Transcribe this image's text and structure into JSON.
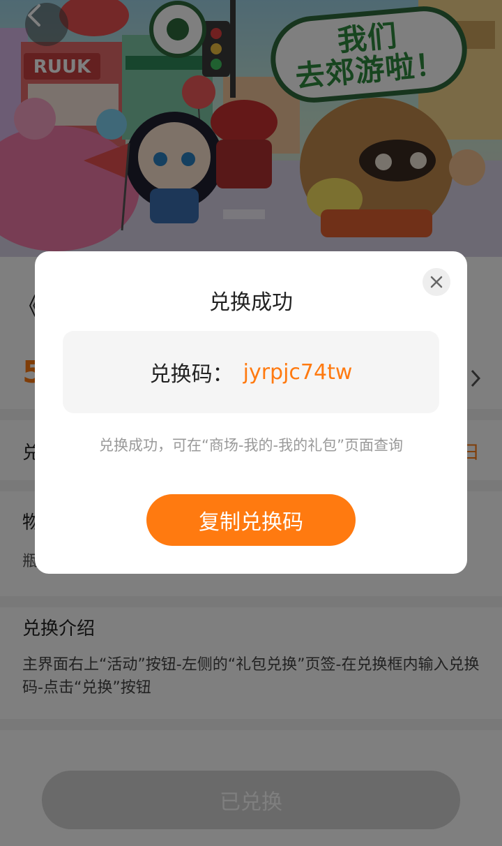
{
  "hero": {
    "bubble_line1": "我们",
    "bubble_line2": "去郊游啦！",
    "shop_sign": "RUUK",
    "icons": [
      "back-arrow-icon",
      "close-icon"
    ]
  },
  "page": {
    "title_prefix": "《",
    "price_prefix": "5",
    "row_label": "兑",
    "row_right_text": "日",
    "item_label": "物",
    "item_value": "瓶",
    "intro_title": "兑换介绍",
    "intro_text": "主界面右上“活动”按钮-左侧的“礼包兑换”页签-在兑换框内输入兑换码-点击“兑换”按钮",
    "redeemed_button": "已兑换"
  },
  "modal": {
    "title": "兑换成功",
    "code_label": "兑换码：",
    "code_value": "jyrpjc74tw",
    "hint": "兑换成功，可在“商场-我的-我的礼包”页面查询",
    "copy_button": "复制兑换码"
  },
  "colors": {
    "accent": "#ff7a10",
    "overlay": "rgba(0,0,0,0.5)",
    "code_box": "#f5f5f5",
    "bubble_text": "#2e8a3e"
  }
}
